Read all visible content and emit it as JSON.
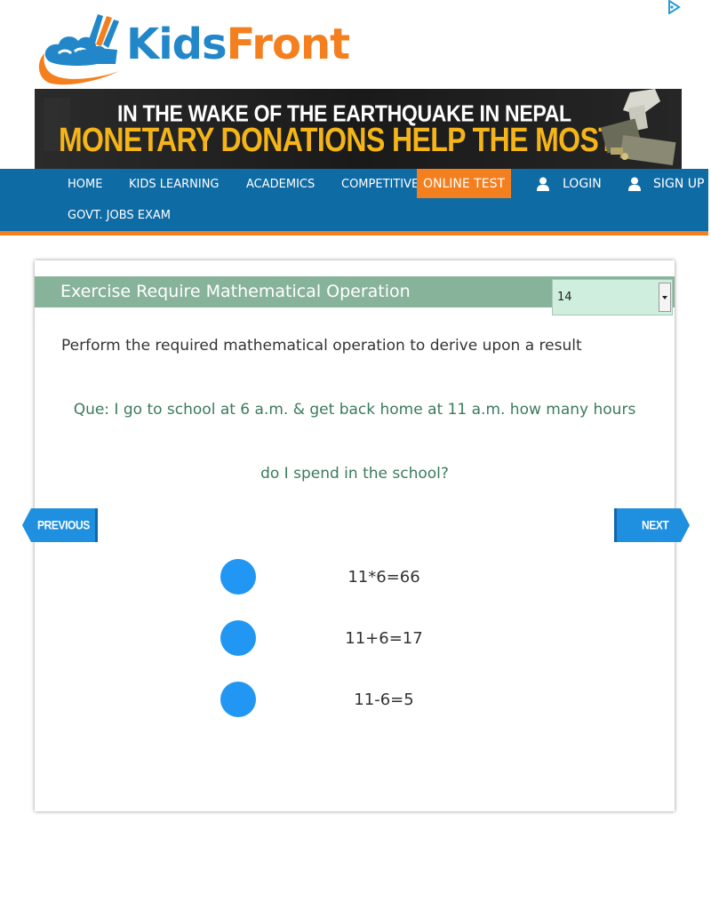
{
  "logo": {
    "part1": "Kids",
    "part2": "Front",
    "icon": "kidsfront-logo-icon",
    "colors": {
      "kids": "#2287c8",
      "front": "#f47f1f"
    }
  },
  "ad": {
    "choices_icon": "adchoices-icon",
    "line1": "IN THE WAKE OF THE EARTHQUAKE IN NEPAL",
    "line2": "MONETARY DONATIONS HELP THE MOST"
  },
  "nav": {
    "items": [
      "HOME",
      "KIDS LEARNING",
      "ACADEMICS",
      "COMPETITIVE EXAMS",
      "GOVT. JOBS EXAM"
    ],
    "online_test": "ONLINE TEST",
    "login": "LOGIN",
    "signup": "SIGN UP",
    "colors": {
      "bar": "#0f6ba4",
      "accent": "#f47f1f"
    }
  },
  "exercise": {
    "title": "Exercise Require Mathematical Operation",
    "page_select": {
      "value": "14"
    },
    "instruction": "Perform the required mathematical operation to derive upon a result",
    "question": "Que: I go to school at 6 a.m. & get back home at 11 a.m. how many hours do I spend in the school?",
    "previous_label": "PREVIOUS",
    "next_label": "NEXT",
    "options": [
      "11*6=66",
      "11+6=17",
      "11-6=5"
    ],
    "colors": {
      "header": "#88b39b",
      "question": "#3b7a5e",
      "radio": "#2196f3"
    }
  }
}
